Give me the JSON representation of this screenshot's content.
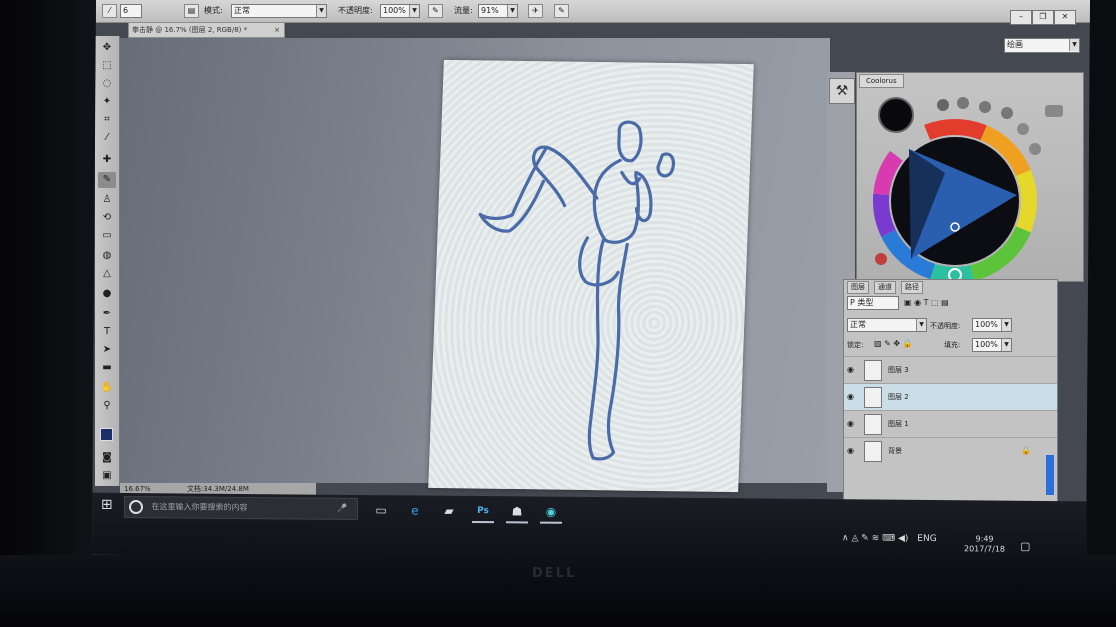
{
  "options_bar": {
    "brush_size": "6",
    "mode_label": "模式:",
    "mode_value": "正常",
    "opacity_label": "不透明度:",
    "opacity_value": "100%",
    "flow_label": "流量:",
    "flow_value": "91%"
  },
  "document_tab": {
    "title": "拳击静 @ 16.7% (图层 2, RGB/8) *",
    "close": "×"
  },
  "workspace_combo": "绘画",
  "coolorus": {
    "title": "Coolorus"
  },
  "layers_panel": {
    "tabs": [
      "图层",
      "通道",
      "路径"
    ],
    "filter_label": "P 类型",
    "blend_mode": "正常",
    "opacity_label": "不透明度:",
    "opacity_value": "100%",
    "lock_label": "锁定:",
    "fill_label": "填充:",
    "fill_value": "100%",
    "layers": [
      {
        "name": "图层 3",
        "selected": false
      },
      {
        "name": "图层 2",
        "selected": true
      },
      {
        "name": "图层 1",
        "selected": false
      },
      {
        "name": "背景",
        "selected": false
      }
    ]
  },
  "status_bar": {
    "zoom": "16.67%",
    "doc_info": "文档:34.3M/24.8M"
  },
  "taskbar": {
    "search_placeholder": "在这里输入你要搜索的内容",
    "language": "ENG",
    "time": "9:49",
    "date": "2017/7/18"
  },
  "colors": {
    "foreground": "#1c2f6b",
    "sketch_stroke": "#4a6aa8",
    "layer_selected": "#c9dee6"
  },
  "brand": "DELL"
}
